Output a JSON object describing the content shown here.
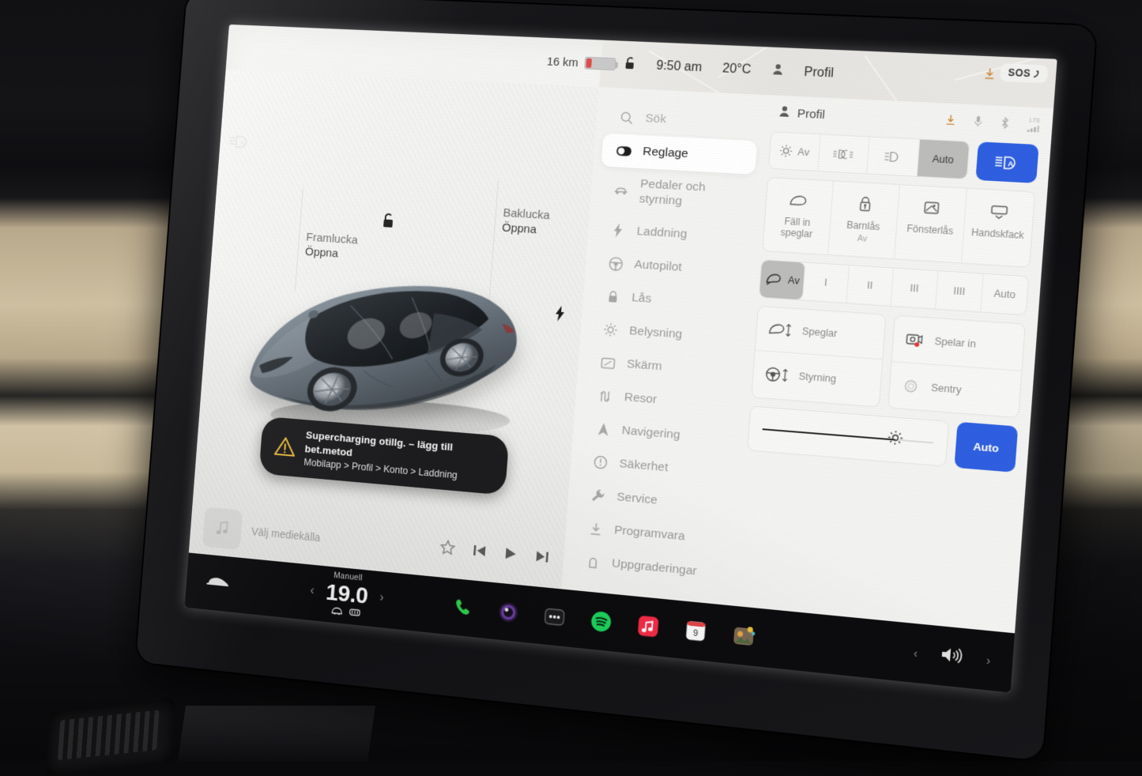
{
  "status_bar": {
    "range": "16 km",
    "time": "9:50 am",
    "outside_temp": "20°C",
    "profile": "Profil",
    "sos": "SOS",
    "lock_icon": "unlock-icon",
    "battery_icon": "battery-low-icon",
    "download_icon": "download-icon"
  },
  "car_view": {
    "front_trunk": {
      "title": "Framlucka",
      "action": "Öppna"
    },
    "rear_trunk": {
      "title": "Baklucka",
      "action": "Öppna"
    },
    "auto_highbeam_indicator": "auto-high-beam-icon",
    "charge_port_icon": "bolt-icon",
    "unlock_icon": "unlock-icon"
  },
  "toast": {
    "title": "Supercharging otillg. – lägg till bet.metod",
    "path": "Mobilapp > Profil > Konto > Laddning",
    "icon": "warning-triangle-icon"
  },
  "media_bar": {
    "source_label": "Välj mediekälla",
    "art_icon": "music-note-icon",
    "controls": [
      "favorite-star-icon",
      "previous-track-icon",
      "play-icon",
      "next-track-icon"
    ]
  },
  "settings": {
    "search_placeholder": "Sök",
    "menu": [
      {
        "label": "Sök",
        "icon": "search-icon",
        "active": false,
        "search": true
      },
      {
        "label": "Reglage",
        "icon": "toggle-icon",
        "active": true
      },
      {
        "label": "Pedaler och styrning",
        "icon": "car-icon",
        "active": false,
        "twoline": true
      },
      {
        "label": "Laddning",
        "icon": "bolt-icon",
        "active": false
      },
      {
        "label": "Autopilot",
        "icon": "steering-wheel-icon",
        "active": false
      },
      {
        "label": "Lås",
        "icon": "lock-icon",
        "active": false
      },
      {
        "label": "Belysning",
        "icon": "sun-icon",
        "active": false
      },
      {
        "label": "Skärm",
        "icon": "display-icon",
        "active": false
      },
      {
        "label": "Resor",
        "icon": "trips-icon",
        "active": false
      },
      {
        "label": "Navigering",
        "icon": "navigation-arrow-icon",
        "active": false
      },
      {
        "label": "Säkerhet",
        "icon": "safety-icon",
        "active": false
      },
      {
        "label": "Service",
        "icon": "wrench-icon",
        "active": false
      },
      {
        "label": "Programvara",
        "icon": "download-icon",
        "active": false
      },
      {
        "label": "Uppgraderingar",
        "icon": "upgrade-lock-icon",
        "active": false
      }
    ],
    "panel_header": {
      "title": "Profil",
      "icon": "person-icon",
      "status_icons": [
        "download-icon",
        "microphone-icon",
        "bluetooth-icon",
        "lte-signal-icon"
      ],
      "lte_label": "LTE"
    },
    "lights_segment": {
      "items": [
        {
          "label": "Av",
          "icon": "lamp-off-icon",
          "selected": false
        },
        {
          "label": "",
          "icon": "parking-lights-icon",
          "selected": false
        },
        {
          "label": "",
          "icon": "low-beam-icon",
          "selected": false
        },
        {
          "label": "Auto",
          "icon": "",
          "selected": true
        }
      ],
      "auto_highbeam_button": {
        "icon": "auto-high-beam-icon",
        "active": true
      }
    },
    "quick_tiles": [
      {
        "label": "Fäll in speglar",
        "icon": "mirror-fold-icon",
        "sub": ""
      },
      {
        "label": "Barnlås",
        "icon": "child-lock-icon",
        "sub": "Av"
      },
      {
        "label": "Fönsterlås",
        "icon": "window-lock-icon",
        "sub": ""
      },
      {
        "label": "Handskfack",
        "icon": "glovebox-icon",
        "sub": ""
      }
    ],
    "wipers": {
      "items": [
        {
          "label": "Av",
          "icon": "wiper-icon",
          "selected": true
        },
        {
          "label": "I",
          "icon": "",
          "selected": false
        },
        {
          "label": "II",
          "icon": "",
          "selected": false
        },
        {
          "label": "III",
          "icon": "",
          "selected": false
        },
        {
          "label": "IIII",
          "icon": "",
          "selected": false
        },
        {
          "label": "Auto",
          "icon": "",
          "selected": false
        }
      ]
    },
    "adjust_grid": {
      "left": [
        {
          "label": "Speglar",
          "icon": "mirror-adjust-icon"
        },
        {
          "label": "Styrning",
          "icon": "steering-adjust-icon"
        }
      ],
      "right": [
        {
          "label": "Spelar in",
          "icon": "dashcam-recording-icon",
          "recording": true
        },
        {
          "label": "Sentry",
          "icon": "sentry-mode-icon",
          "recording": false
        }
      ]
    },
    "brightness": {
      "value_pct": 78,
      "knob_icon": "brightness-sun-icon",
      "auto_label": "Auto"
    }
  },
  "bottom_bar": {
    "car_icon": "car-icon",
    "climate": {
      "mode": "Manuell",
      "temperature": "19.0",
      "left_chevron": "chevron-left-icon",
      "right_chevron": "chevron-right-icon",
      "defrost_icons": [
        "front-defrost-icon",
        "rear-defrost-icon"
      ]
    },
    "dock": [
      {
        "name": "phone-app",
        "icon": "phone-icon",
        "color": "#2fd44f"
      },
      {
        "name": "camera-app",
        "icon": "camera-icon",
        "color": "#6a3fa0"
      },
      {
        "name": "app-launcher",
        "icon": "dots-icon",
        "color": "#1c1c1e"
      },
      {
        "name": "spotify-app",
        "icon": "spotify-icon",
        "color": "#1ed760"
      },
      {
        "name": "apple-music-app",
        "icon": "music-note-icon",
        "color": "#fa2d48"
      },
      {
        "name": "calendar-app",
        "icon": "calendar-icon",
        "color": "#ffffff",
        "day": "9"
      },
      {
        "name": "photos-app",
        "icon": "photos-icon",
        "color": "#6b5b4a"
      }
    ],
    "volume": {
      "icon": "speaker-icon",
      "left_chevron": "chevron-left-icon",
      "right_chevron": "chevron-right-icon"
    }
  },
  "colors": {
    "accent_blue": "#2f5fe0",
    "screen_bg": "#f3f3f1",
    "selected_gray": "#bcbcba",
    "recording_red": "#e03b3b",
    "warning_yellow": "#f0c040"
  }
}
